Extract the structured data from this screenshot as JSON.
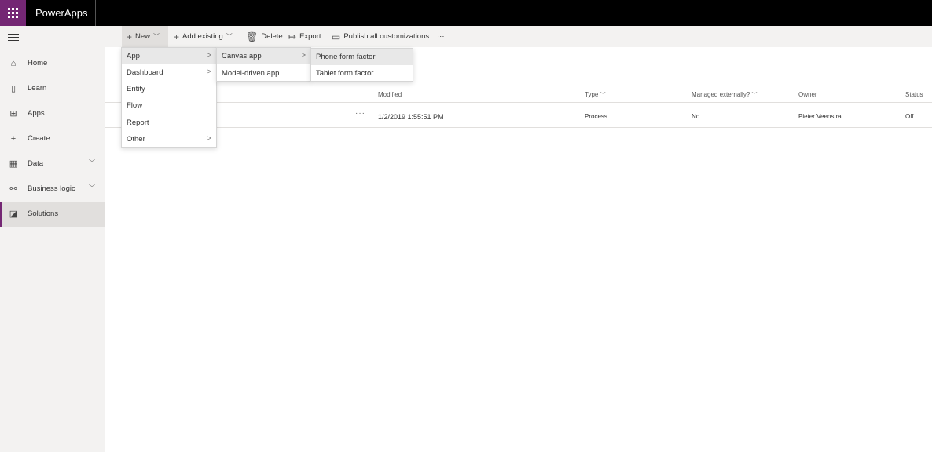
{
  "app": {
    "name": "PowerApps"
  },
  "nav": {
    "items": [
      {
        "label": "Home",
        "icon": "home-icon",
        "glyph": "⌂"
      },
      {
        "label": "Learn",
        "icon": "book-icon",
        "glyph": "▯"
      },
      {
        "label": "Apps",
        "icon": "apps-icon",
        "glyph": "⊞"
      },
      {
        "label": "Create",
        "icon": "plus-icon",
        "glyph": "+"
      },
      {
        "label": "Data",
        "icon": "table-icon",
        "glyph": "▦"
      },
      {
        "label": "Business logic",
        "icon": "flow-icon",
        "glyph": "⚯"
      },
      {
        "label": "Solutions",
        "icon": "solutions-icon",
        "glyph": "◪"
      }
    ]
  },
  "commandbar": {
    "new_label": "New",
    "add_existing_label": "Add existing",
    "delete_label": "Delete",
    "export_label": "Export",
    "publish_label": "Publish all customizations",
    "more_label": "···"
  },
  "table": {
    "columns": [
      "Modified",
      "Type",
      "Managed externally?",
      "Owner",
      "Status"
    ],
    "rows": [
      {
        "more": "···",
        "modified": "1/2/2019 1:55:51 PM",
        "type": "Process",
        "managed": "No",
        "owner": "Pieter Veenstra",
        "status": "Off"
      }
    ]
  },
  "menus": {
    "new": [
      "App",
      "Dashboard",
      "Entity",
      "Flow",
      "Report",
      "Other"
    ],
    "app": [
      "Canvas app",
      "Model-driven app"
    ],
    "canvas": [
      "Phone form factor",
      "Tablet form factor"
    ]
  }
}
